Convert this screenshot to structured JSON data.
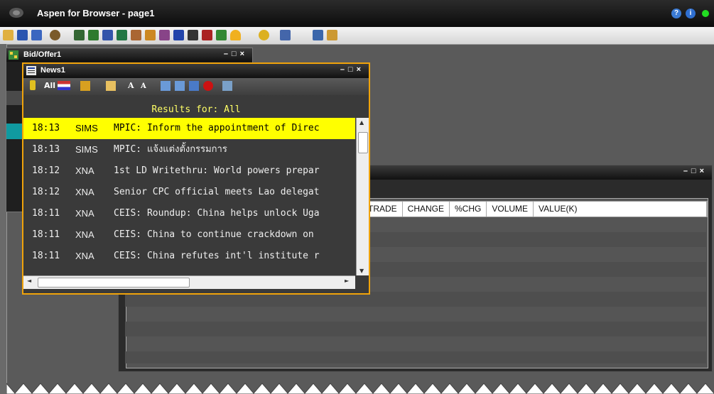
{
  "app": {
    "title": "Aspen for Browser - page1"
  },
  "titlebar_icons": [
    "help-icon",
    "info-icon",
    "status-dot-icon"
  ],
  "toolbar_icons": [
    "open-icon",
    "save-icon",
    "save-as-icon",
    "layout-icon",
    "chart-icon",
    "spreadsheet-icon",
    "quote-icon",
    "grid-icon",
    "pie-icon",
    "sector-icon",
    "ranking-icon",
    "monitor-icon",
    "tick-icon",
    "finance-icon",
    "index-icon",
    "alert-bell-icon",
    "user-icon",
    "network-icon",
    "trade-icon",
    "portfolio-icon"
  ],
  "windows": {
    "bid_offer": {
      "title": "Bid/Offer1"
    },
    "news": {
      "title": "News1",
      "tools_labels": {
        "all": "All",
        "font_up": "A",
        "font_down": "A"
      },
      "results_label": "Results for: All",
      "items": [
        {
          "time": "18:13",
          "source": "SIMS",
          "headline": "MPIC: Inform the appointment of Direc",
          "selected": true
        },
        {
          "time": "18:13",
          "source": "SIMS",
          "headline": "MPIC: แจ้งแต่งตั้งกรรมการ",
          "selected": false
        },
        {
          "time": "18:12",
          "source": "XNA",
          "headline": "1st LD Writethru: World powers prepar",
          "selected": false
        },
        {
          "time": "18:12",
          "source": "XNA",
          "headline": "Senior CPC official meets Lao delegat",
          "selected": false
        },
        {
          "time": "18:11",
          "source": "XNA",
          "headline": "CEIS: Roundup: China helps unlock Uga",
          "selected": false
        },
        {
          "time": "18:11",
          "source": "XNA",
          "headline": "CEIS: China to continue crackdown on",
          "selected": false
        },
        {
          "time": "18:11",
          "source": "XNA",
          "headline": "CEIS: China refutes int'l institute r",
          "selected": false
        }
      ]
    },
    "table": {
      "columns": [
        "TRADE",
        "CHANGE",
        "%CHG",
        "VOLUME",
        "VALUE(K)"
      ]
    }
  },
  "colors": {
    "selected_row": "#ffff00",
    "results_text": "#ffff66",
    "news_border": "#f0a30a"
  }
}
